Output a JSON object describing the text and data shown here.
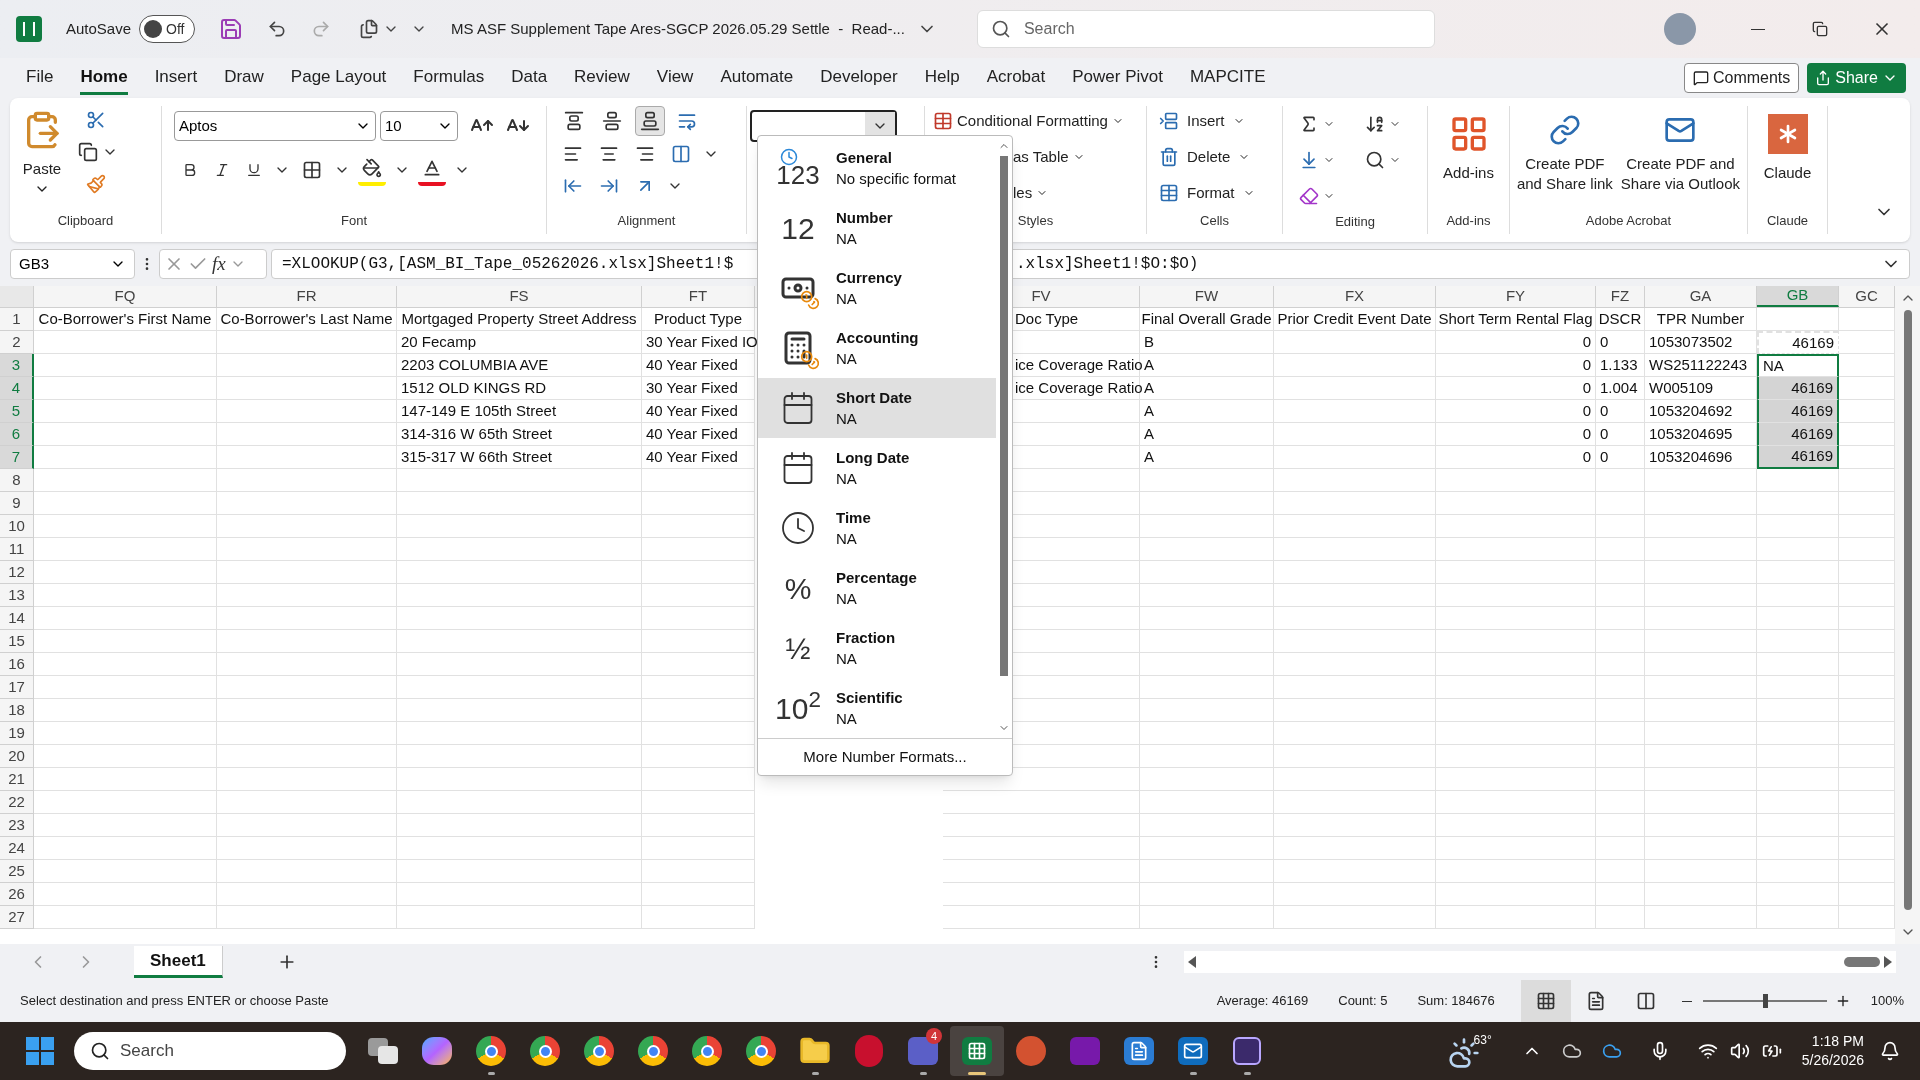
{
  "title_bar": {
    "autosave_label": "AutoSave",
    "autosave": {
      "on": false,
      "label": "Off"
    },
    "title": "MS ASF Supplement Tape Ares-SGCP 2026.05.29 Settle  -  Read-...",
    "search": {
      "placeholder": "Search"
    }
  },
  "menu_tabs": [
    {
      "label": "File",
      "selected": false
    },
    {
      "label": "Home",
      "selected": true
    },
    {
      "label": "Insert",
      "selected": false
    },
    {
      "label": "Draw",
      "selected": false
    },
    {
      "label": "Page Layout",
      "selected": false
    },
    {
      "label": "Formulas",
      "selected": false
    },
    {
      "label": "Data",
      "selected": false
    },
    {
      "label": "Review",
      "selected": false
    },
    {
      "label": "View",
      "selected": false
    },
    {
      "label": "Automate",
      "selected": false
    },
    {
      "label": "Developer",
      "selected": false
    },
    {
      "label": "Help",
      "selected": false
    },
    {
      "label": "Acrobat",
      "selected": false
    },
    {
      "label": "Power Pivot",
      "selected": false
    },
    {
      "label": "MAPCITE",
      "selected": false
    }
  ],
  "comments_button": "Comments",
  "share_button": "Share",
  "ribbon": {
    "clipboard": {
      "paste": "Paste",
      "label": "Clipboard"
    },
    "font": {
      "font_name": "Aptos",
      "font_size": "10",
      "label": "Font"
    },
    "alignment": {
      "label": "Alignment",
      "vertical": [
        {
          "selected": false
        },
        {
          "selected": false
        },
        {
          "selected": true
        }
      ]
    },
    "styles": {
      "items": [
        "Conditional Formatting",
        "as Table",
        "les"
      ],
      "label": "Styles"
    },
    "cells": {
      "items": [
        "Insert",
        "Delete",
        "Format"
      ],
      "label": "Cells"
    },
    "editing": {
      "label": "Editing"
    },
    "addins": {
      "button": "Add-ins",
      "label": "Add-ins"
    },
    "adobe": {
      "buttons": [
        "Create PDF\nand Share link",
        "Create PDF and\nShare via Outlook"
      ],
      "label": "Adobe Acrobat"
    },
    "claude": {
      "button": "Claude",
      "label": "Claude"
    }
  },
  "formula_bar": {
    "name_box": "GB3",
    "function_label": "fx",
    "formula_start": "=XLOOKUP(G3,[ASM_BI_Tape_05262026.xlsx]Sheet1!$",
    "formula_end": ".xlsx]Sheet1!$O:$O)"
  },
  "grid": {
    "columns": [
      {
        "letter": "FQ",
        "selected": false
      },
      {
        "letter": "FR",
        "selected": false
      },
      {
        "letter": "FS",
        "selected": false
      },
      {
        "letter": "FT",
        "selected": false
      },
      {
        "letter": "FV",
        "selected": false
      },
      {
        "letter": "FW",
        "selected": false
      },
      {
        "letter": "FX",
        "selected": false
      },
      {
        "letter": "FY",
        "selected": false
      },
      {
        "letter": "FZ",
        "selected": false
      },
      {
        "letter": "GA",
        "selected": false
      },
      {
        "letter": "GB",
        "selected": true
      },
      {
        "letter": "GC",
        "selected": false
      }
    ],
    "rows": [
      {
        "num": "1",
        "selected": false,
        "cells": [
          {
            "kind": "heading",
            "text": "Co-Borrower's First Name"
          },
          {
            "kind": "heading",
            "text": "Co-Borrower's Last Name"
          },
          {
            "kind": "heading",
            "text": "Mortgaged Property Street Address"
          },
          {
            "kind": "heading",
            "text": "Product Type"
          },
          {
            "kind": "text",
            "text": "Doc Type"
          },
          {
            "kind": "heading",
            "text": "Final Overall Grade"
          },
          {
            "kind": "heading",
            "text": "Prior Credit Event Date"
          },
          {
            "kind": "heading",
            "text": "Short Term Rental Flag"
          },
          {
            "kind": "heading",
            "text": "DSCR"
          },
          {
            "kind": "heading",
            "text": "TPR Number"
          }
        ]
      },
      {
        "num": "2",
        "selected": false,
        "cells": [
          {
            "kind": "text",
            "text": ""
          },
          {
            "kind": "text",
            "text": ""
          },
          {
            "kind": "text",
            "text": "20 Fecamp"
          },
          {
            "kind": "text",
            "text": "30 Year Fixed IO"
          },
          {
            "kind": "text",
            "text": ""
          },
          {
            "kind": "text",
            "text": "B"
          },
          {
            "kind": "text",
            "text": ""
          },
          {
            "kind": "number",
            "text": "0"
          },
          {
            "kind": "text",
            "text": "0"
          },
          {
            "kind": "text",
            "text": "1053073502"
          },
          {
            "kind": "number",
            "text": "46169",
            "selected": false,
            "active": false,
            "copied": true
          }
        ]
      },
      {
        "num": "3",
        "selected": true,
        "cells": [
          {
            "kind": "text",
            "text": ""
          },
          {
            "kind": "text",
            "text": ""
          },
          {
            "kind": "text",
            "text": "2203 COLUMBIA AVE"
          },
          {
            "kind": "text",
            "text": "40 Year Fixed"
          },
          {
            "kind": "text",
            "text": "ice Coverage Ratio"
          },
          {
            "kind": "text",
            "text": "A"
          },
          {
            "kind": "text",
            "text": ""
          },
          {
            "kind": "number",
            "text": "0"
          },
          {
            "kind": "text",
            "text": "1.133"
          },
          {
            "kind": "text",
            "text": "WS251122243"
          },
          {
            "kind": "text",
            "text": "NA",
            "selected": true,
            "active": true,
            "copied": false
          }
        ]
      },
      {
        "num": "4",
        "selected": true,
        "cells": [
          {
            "kind": "text",
            "text": ""
          },
          {
            "kind": "text",
            "text": ""
          },
          {
            "kind": "text",
            "text": "1512 OLD KINGS RD"
          },
          {
            "kind": "text",
            "text": "30 Year Fixed"
          },
          {
            "kind": "text",
            "text": "ice Coverage Ratio"
          },
          {
            "kind": "text",
            "text": "A"
          },
          {
            "kind": "text",
            "text": ""
          },
          {
            "kind": "number",
            "text": "0"
          },
          {
            "kind": "text",
            "text": "1.004"
          },
          {
            "kind": "text",
            "text": "W005109"
          },
          {
            "kind": "number",
            "text": "46169",
            "selected": true,
            "active": false,
            "copied": false
          }
        ]
      },
      {
        "num": "5",
        "selected": true,
        "cells": [
          {
            "kind": "text",
            "text": ""
          },
          {
            "kind": "text",
            "text": ""
          },
          {
            "kind": "text",
            "text": "147-149 E 105th Street"
          },
          {
            "kind": "text",
            "text": "40 Year Fixed"
          },
          {
            "kind": "text",
            "text": ""
          },
          {
            "kind": "text",
            "text": "A"
          },
          {
            "kind": "text",
            "text": ""
          },
          {
            "kind": "number",
            "text": "0"
          },
          {
            "kind": "text",
            "text": "0"
          },
          {
            "kind": "text",
            "text": "1053204692"
          },
          {
            "kind": "number",
            "text": "46169",
            "selected": true,
            "active": false,
            "copied": false
          }
        ]
      },
      {
        "num": "6",
        "selected": true,
        "cells": [
          {
            "kind": "text",
            "text": ""
          },
          {
            "kind": "text",
            "text": ""
          },
          {
            "kind": "text",
            "text": "314-316 W 65th Street"
          },
          {
            "kind": "text",
            "text": "40 Year Fixed"
          },
          {
            "kind": "text",
            "text": ""
          },
          {
            "kind": "text",
            "text": "A"
          },
          {
            "kind": "text",
            "text": ""
          },
          {
            "kind": "number",
            "text": "0"
          },
          {
            "kind": "text",
            "text": "0"
          },
          {
            "kind": "text",
            "text": "1053204695"
          },
          {
            "kind": "number",
            "text": "46169",
            "selected": true,
            "active": false,
            "copied": false
          }
        ]
      },
      {
        "num": "7",
        "selected": true,
        "cells": [
          {
            "kind": "text",
            "text": ""
          },
          {
            "kind": "text",
            "text": ""
          },
          {
            "kind": "text",
            "text": "315-317 W 66th Street"
          },
          {
            "kind": "text",
            "text": "40 Year Fixed"
          },
          {
            "kind": "text",
            "text": ""
          },
          {
            "kind": "text",
            "text": "A"
          },
          {
            "kind": "text",
            "text": ""
          },
          {
            "kind": "number",
            "text": "0"
          },
          {
            "kind": "text",
            "text": "0"
          },
          {
            "kind": "text",
            "text": "1053204696"
          },
          {
            "kind": "number",
            "text": "46169",
            "selected": true,
            "active": false,
            "copied": false
          }
        ]
      },
      {
        "num": "8",
        "selected": false,
        "cells": []
      },
      {
        "num": "9",
        "selected": false,
        "cells": []
      },
      {
        "num": "10",
        "selected": false,
        "cells": []
      },
      {
        "num": "11",
        "selected": false,
        "cells": []
      },
      {
        "num": "12",
        "selected": false,
        "cells": []
      },
      {
        "num": "13",
        "selected": false,
        "cells": []
      },
      {
        "num": "14",
        "selected": false,
        "cells": []
      },
      {
        "num": "15",
        "selected": false,
        "cells": []
      },
      {
        "num": "16",
        "selected": false,
        "cells": []
      },
      {
        "num": "17",
        "selected": false,
        "cells": []
      },
      {
        "num": "18",
        "selected": false,
        "cells": []
      },
      {
        "num": "19",
        "selected": false,
        "cells": []
      },
      {
        "num": "20",
        "selected": false,
        "cells": []
      },
      {
        "num": "21",
        "selected": false,
        "cells": []
      },
      {
        "num": "22",
        "selected": false,
        "cells": []
      },
      {
        "num": "23",
        "selected": false,
        "cells": []
      },
      {
        "num": "24",
        "selected": false,
        "cells": []
      },
      {
        "num": "25",
        "selected": false,
        "cells": []
      },
      {
        "num": "26",
        "selected": false,
        "cells": []
      },
      {
        "num": "27",
        "selected": false,
        "cells": []
      }
    ]
  },
  "number_format_menu": {
    "items": [
      {
        "kind": "general",
        "glyph": "123",
        "name": "General",
        "example": "No specific format",
        "selected": false
      },
      {
        "kind": "number",
        "glyph": "12",
        "name": "Number",
        "example": "NA",
        "selected": false
      },
      {
        "kind": "currency",
        "name": "Currency",
        "example": "NA",
        "selected": false
      },
      {
        "kind": "accounting",
        "name": "Accounting",
        "example": "NA",
        "selected": false
      },
      {
        "kind": "short_date",
        "name": "Short Date",
        "example": "NA",
        "selected": true
      },
      {
        "kind": "long_date",
        "name": "Long Date",
        "example": "NA",
        "selected": false
      },
      {
        "kind": "time",
        "name": "Time",
        "example": "NA",
        "selected": false
      },
      {
        "kind": "percentage",
        "glyph": "%",
        "name": "Percentage",
        "example": "NA",
        "selected": false
      },
      {
        "kind": "fraction",
        "glyph": "½",
        "name": "Fraction",
        "example": "NA",
        "selected": false
      },
      {
        "kind": "scientific",
        "glyph": "10$^{2}$",
        "name": "Scientific",
        "example": "NA",
        "selected": false
      }
    ],
    "more": "More Number Formats..."
  },
  "sheet_tabs": [
    {
      "label": "Sheet1",
      "selected": true
    }
  ],
  "status_bar": {
    "message": "Select destination and press ENTER or choose Paste",
    "average": "Average: 46169",
    "count": "Count: 5",
    "sum": "Sum: 184676",
    "views": [
      {
        "selected": true
      },
      {
        "selected": false
      },
      {
        "selected": false
      }
    ],
    "zoom": {
      "level": 0.5,
      "label": "100%"
    }
  },
  "taskbar": {
    "search": {
      "placeholder": "Search"
    },
    "apps": [
      {
        "kind": "taskview",
        "running": false,
        "selected": false
      },
      {
        "kind": "blob",
        "running": false,
        "selected": false
      },
      {
        "kind": "browser",
        "running": true,
        "selected": false
      },
      {
        "kind": "browser",
        "running": false,
        "selected": false
      },
      {
        "kind": "browser",
        "running": false,
        "selected": false
      },
      {
        "kind": "browser",
        "running": false,
        "selected": false
      },
      {
        "kind": "browser",
        "running": false,
        "selected": false
      },
      {
        "kind": "browser",
        "running": false,
        "selected": false
      },
      {
        "kind": "folder",
        "running": true,
        "selected": false
      },
      {
        "kind": "red",
        "running": false,
        "selected": false
      },
      {
        "kind": "purple",
        "running": true,
        "selected": false,
        "badge": "4"
      },
      {
        "kind": "green",
        "running": true,
        "selected": true
      },
      {
        "kind": "orange",
        "running": false,
        "selected": false
      },
      {
        "kind": "violet",
        "running": false,
        "selected": false
      },
      {
        "kind": "blue",
        "running": false,
        "selected": false
      },
      {
        "kind": "mail",
        "running": true,
        "selected": false
      },
      {
        "kind": "dark",
        "running": true,
        "selected": false
      }
    ],
    "weather": "63°",
    "time": "1:18 PM",
    "date": "5/26/2026"
  }
}
